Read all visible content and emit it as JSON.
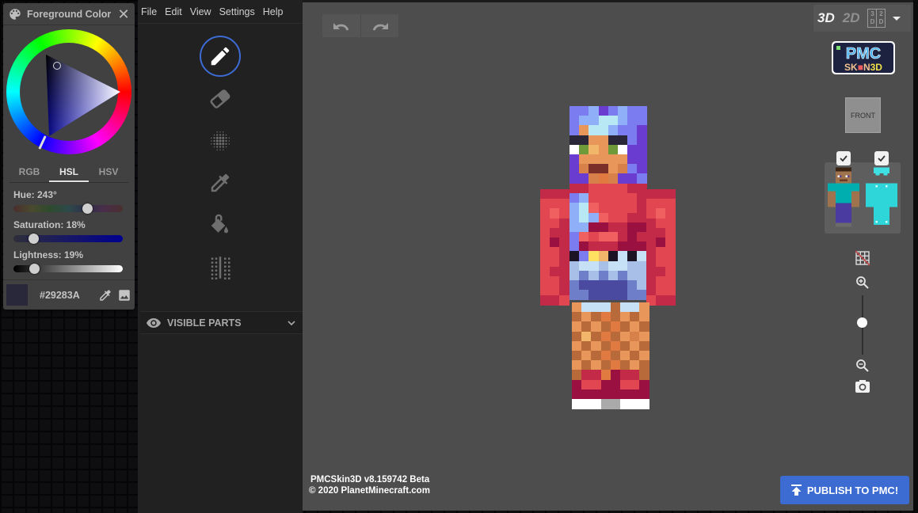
{
  "color_panel": {
    "title": "Foreground Color",
    "tabs": [
      {
        "label": "RGB",
        "active": false
      },
      {
        "label": "HSL",
        "active": true
      },
      {
        "label": "HSV",
        "active": false
      }
    ],
    "hue": {
      "label": "Hue: 243°",
      "value": 243,
      "max": 360
    },
    "saturation": {
      "label": "Saturation: 18%",
      "value": 18,
      "max": 100
    },
    "lightness": {
      "label": "Lightness: 19%",
      "value": 19,
      "max": 100
    },
    "hex": "#29283A",
    "swatch_color": "#29283a",
    "icons": [
      "palette-icon",
      "close-icon",
      "eyedropper-icon",
      "image-icon"
    ]
  },
  "menu": {
    "items": [
      "File",
      "Edit",
      "View",
      "Settings",
      "Help"
    ]
  },
  "tools": [
    {
      "name": "pencil",
      "active": true
    },
    {
      "name": "eraser",
      "active": false
    },
    {
      "name": "noise-brush",
      "active": false
    },
    {
      "name": "color-picker",
      "active": false
    },
    {
      "name": "bucket-fill",
      "active": false
    },
    {
      "name": "mirror",
      "active": false
    }
  ],
  "visible_parts": {
    "label": "VISIBLE PARTS",
    "expanded": false
  },
  "viewport": {
    "view_modes": {
      "mode_3d": "3D",
      "mode_2d": "2D",
      "split_left": "3 D",
      "split_right": "2 D",
      "active": "3D"
    },
    "front_button": "FRONT",
    "layers": [
      {
        "name": "base-layer",
        "checked": true
      },
      {
        "name": "overlay-layer",
        "checked": true
      }
    ],
    "zoom_level": 0.55,
    "version_line1": "PMCSkin3D v8.159742 Beta",
    "version_line2": "© 2020 PlanetMinecraft.com",
    "publish_label": "PUBLISH TO PMC!",
    "accent_color": "#3c6bd2"
  }
}
